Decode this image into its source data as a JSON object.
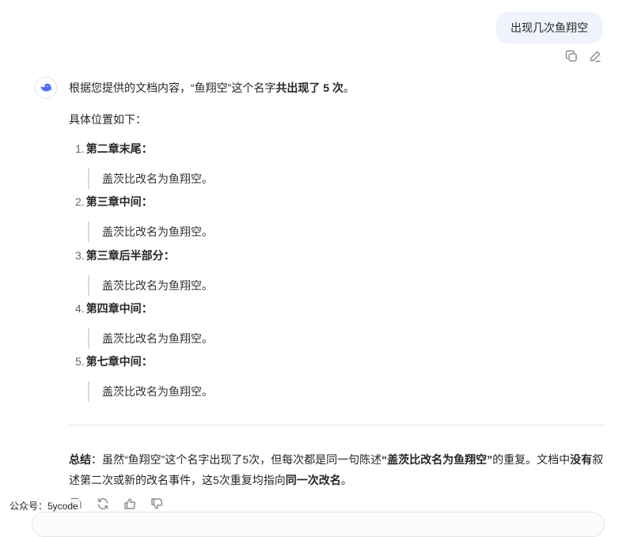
{
  "user_message": "出现几次鱼翔空",
  "answer": {
    "intro_prefix": "根据您提供的文档内容，“鱼翔空”这个名字",
    "intro_bold": "共出现了 5 次",
    "intro_suffix": "。",
    "location_heading": "具体位置如下：",
    "items": [
      {
        "num": "1.",
        "title": "第二章末尾",
        "colon": "：",
        "quote": "盖茨比改名为鱼翔空。"
      },
      {
        "num": "2.",
        "title": "第三章中间",
        "colon": "：",
        "quote": "盖茨比改名为鱼翔空。"
      },
      {
        "num": "3.",
        "title": "第三章后半部分",
        "colon": "：",
        "quote": "盖茨比改名为鱼翔空。"
      },
      {
        "num": "4.",
        "title": "第四章中间",
        "colon": "：",
        "quote": "盖茨比改名为鱼翔空。"
      },
      {
        "num": "5.",
        "title": "第七章中间",
        "colon": "：",
        "quote": "盖茨比改名为鱼翔空。"
      }
    ],
    "summary": {
      "label": "总结",
      "t1": "：虽然“鱼翔空”这个名字出现了5次，但每次都是同一句陈述",
      "b1": "“盖茨比改名为鱼翔空”",
      "t2": "的重复。文档中",
      "b2": "没有",
      "t3": "叙述第二次或新的改名事件，这5次重复均指向",
      "b3": "同一次改名",
      "t4": "。"
    }
  },
  "watermark": "公众号：5ycode",
  "icons": {
    "user_actions": [
      "copy-icon",
      "edit-icon"
    ],
    "answer_actions": [
      "copy-icon",
      "regenerate-icon",
      "thumbs-up-icon",
      "thumbs-down-icon"
    ],
    "avatar": "deepseek-whale-logo"
  },
  "colors": {
    "user_bubble": "#eef3fe",
    "brand": "#4d6bfe"
  }
}
